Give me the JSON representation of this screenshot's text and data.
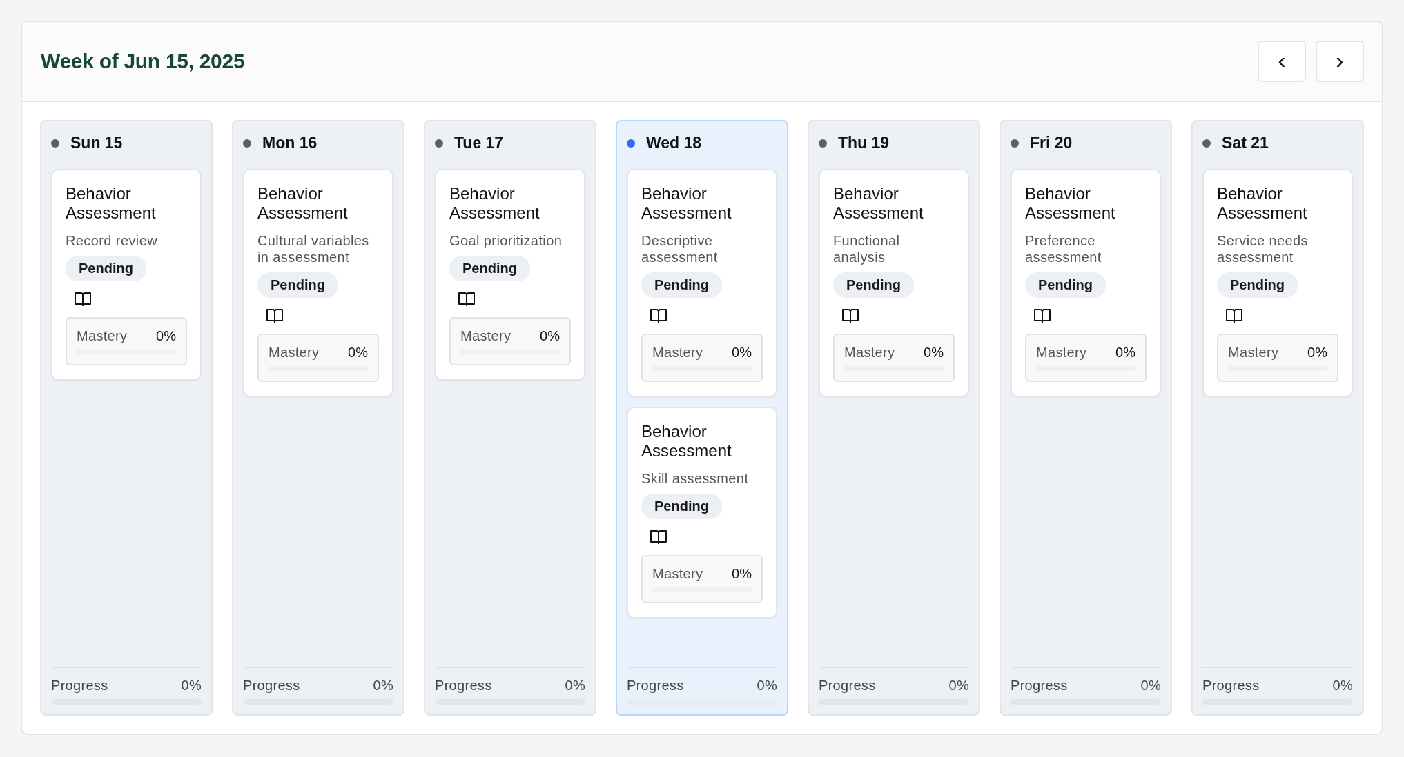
{
  "header": {
    "title": "Week of Jun 15, 2025",
    "prev_button": "‹",
    "next_button": "›"
  },
  "days": [
    {
      "label": "Sun 15",
      "selected": false,
      "tasks": [
        {
          "title": "Behavior Assessment",
          "subtitle": "Record review",
          "status": "Pending",
          "mastery_label": "Mastery",
          "mastery_value": "0%",
          "level": 0
        }
      ],
      "progress_label": "Progress",
      "progress_value": "0%",
      "level": 0
    },
    {
      "label": "Mon 16",
      "selected": false,
      "tasks": [
        {
          "title": "Behavior Assessment",
          "subtitle": "Cultural variables in assessment",
          "status": "Pending",
          "mastery_label": "Mastery",
          "mastery_value": "0%",
          "level": 0
        }
      ],
      "progress_label": "Progress",
      "progress_value": "0%",
      "level": 0
    },
    {
      "label": "Tue 17",
      "selected": false,
      "tasks": [
        {
          "title": "Behavior Assessment",
          "subtitle": "Goal prioritization",
          "status": "Pending",
          "mastery_label": "Mastery",
          "mastery_value": "0%",
          "level": 0
        }
      ],
      "progress_label": "Progress",
      "progress_value": "0%",
      "level": 0
    },
    {
      "label": "Wed 18",
      "selected": true,
      "tasks": [
        {
          "title": "Behavior Assessment",
          "subtitle": "Descriptive assessment",
          "status": "Pending",
          "mastery_label": "Mastery",
          "mastery_value": "0%",
          "level": 0
        },
        {
          "title": "Behavior Assessment",
          "subtitle": "Skill assessment",
          "status": "Pending",
          "mastery_label": "Mastery",
          "mastery_value": "0%",
          "level": 0
        }
      ],
      "progress_label": "Progress",
      "progress_value": "0%",
      "level": 0
    },
    {
      "label": "Thu 19",
      "selected": false,
      "tasks": [
        {
          "title": "Behavior Assessment",
          "subtitle": "Functional analysis",
          "status": "Pending",
          "mastery_label": "Mastery",
          "mastery_value": "0%",
          "level": 0
        }
      ],
      "progress_label": "Progress",
      "progress_value": "0%",
      "level": 0
    },
    {
      "label": "Fri 20",
      "selected": false,
      "tasks": [
        {
          "title": "Behavior Assessment",
          "subtitle": "Preference assessment",
          "status": "Pending",
          "mastery_label": "Mastery",
          "mastery_value": "0%",
          "level": 0
        }
      ],
      "progress_label": "Progress",
      "progress_value": "0%",
      "level": 0
    },
    {
      "label": "Sat 21",
      "selected": false,
      "tasks": [
        {
          "title": "Behavior Assessment",
          "subtitle": "Service needs assessment",
          "status": "Pending",
          "mastery_label": "Mastery",
          "mastery_value": "0%",
          "level": 0
        }
      ],
      "progress_label": "Progress",
      "progress_value": "0%",
      "level": 0
    }
  ]
}
